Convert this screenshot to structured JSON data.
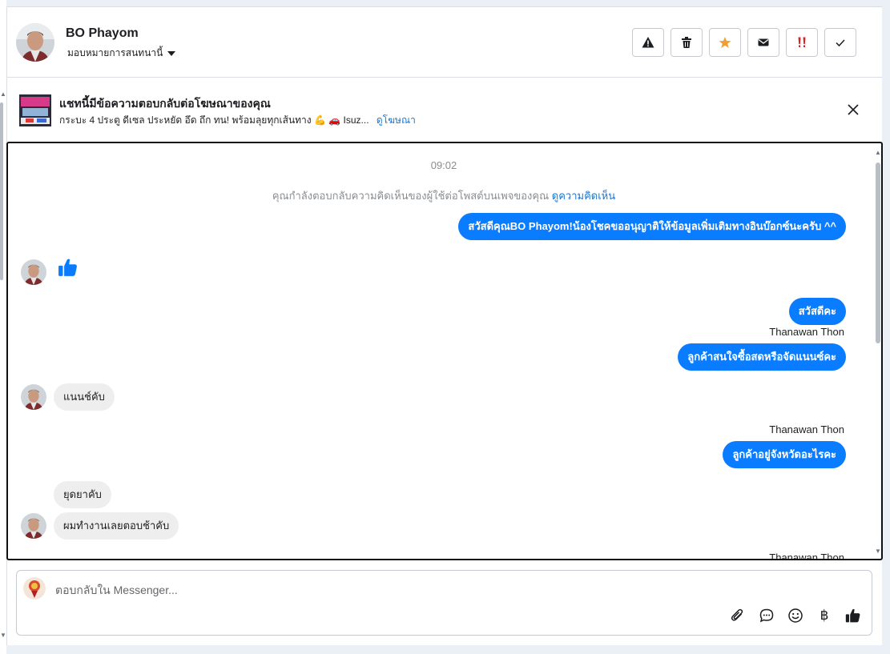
{
  "header": {
    "name": "BO Phayom",
    "assign_label": "มอบหมายการสนทนานี้",
    "actions": [
      {
        "name": "spam-button",
        "icon": "warning-icon"
      },
      {
        "name": "delete-button",
        "icon": "trash-icon"
      },
      {
        "name": "follow-up-button",
        "icon": "star-icon"
      },
      {
        "name": "mark-unread-button",
        "icon": "envelope-icon"
      },
      {
        "name": "priority-button",
        "icon": "double-exclamation-icon"
      },
      {
        "name": "mark-done-button",
        "icon": "check-icon"
      }
    ]
  },
  "ad": {
    "title": "แชทนี้มีข้อความตอบกลับต่อโฆษณาของคุณ",
    "subtitle": "กระบะ 4 ประตู ดีเซล ประหยัด อึด ถึก ทน! พร้อมลุยทุกเส้นทาง 💪 🚗 Isuz...",
    "link": "ดูโฆษณา"
  },
  "chat": {
    "time": "09:02",
    "system_note": "คุณกำลังตอบกลับความคิดเห็นของผู้ใช้ต่อโพสต์บนเพจของคุณ",
    "system_link": "ดูความคิดเห็น",
    "messages": [
      {
        "dir": "out",
        "text": "สวัสดีคุณBO Phayom!น้องโชคขออนุญาติให้ข้อมูลเพิ่มเติมทางอินบ๊อกซ์นะครับ ^^"
      },
      {
        "dir": "in",
        "text": "",
        "sticker": "like-icon"
      },
      {
        "dir": "out",
        "text": "สวัสดีคะ"
      },
      {
        "dir": "sender",
        "text": "Thanawan Thon"
      },
      {
        "dir": "out",
        "text": "ลูกค้าสนใจซื้อสดหรือจัดแนนซ์คะ"
      },
      {
        "dir": "in",
        "text": "แนนช์คับ"
      },
      {
        "dir": "sender",
        "text": "Thanawan Thon"
      },
      {
        "dir": "out",
        "text": "ลูกค้าอยู่จังหวัดอะไรคะ"
      },
      {
        "dir": "in",
        "text": "ยุดยาคับ"
      },
      {
        "dir": "in",
        "text": "ผมทำงานเลยตอบช้าคับ"
      },
      {
        "dir": "sender",
        "text": "Thanawan Thon"
      }
    ]
  },
  "composer": {
    "placeholder": "ตอบกลับใน Messenger...",
    "tools": [
      "paperclip-icon",
      "chat-bubble-icon",
      "smiley-icon",
      "baht-icon",
      "like-icon"
    ],
    "baht_symbol": "฿"
  },
  "colors": {
    "accent_blue": "#0a7cff",
    "link_blue": "#1876d2",
    "incoming_bubble": "#eeeeef",
    "star_orange": "#f0a030",
    "priority_red": "#e02020"
  }
}
